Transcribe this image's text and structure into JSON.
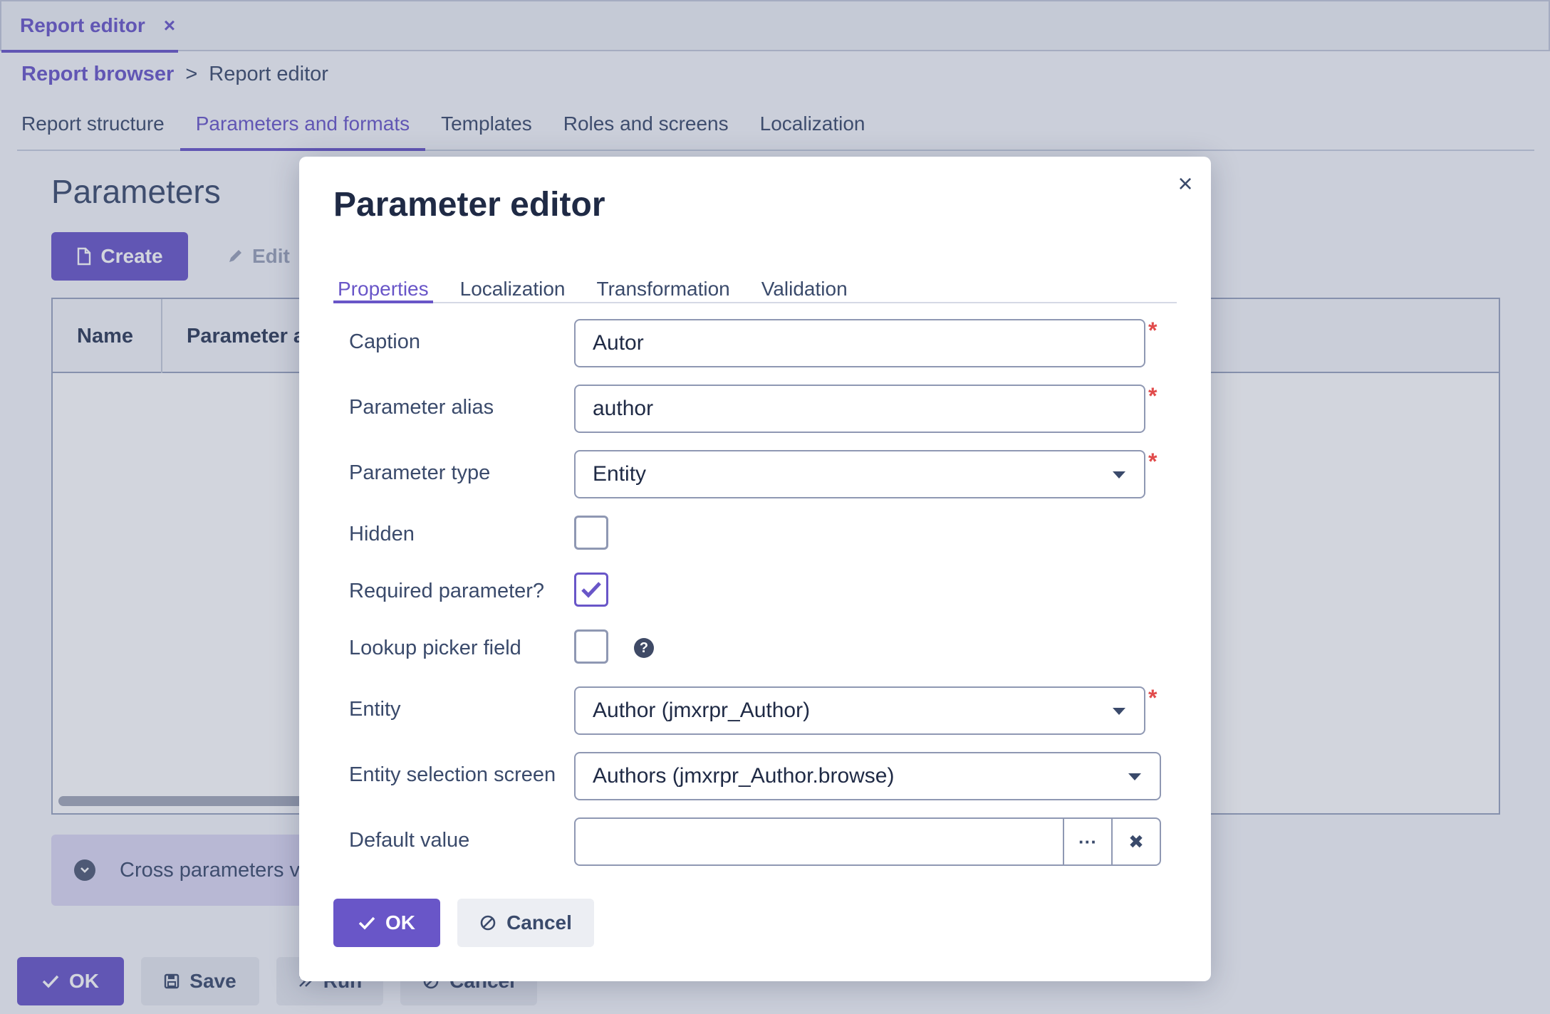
{
  "top_tab": {
    "label": "Report editor",
    "close": "×"
  },
  "breadcrumb": {
    "parent": "Report browser",
    "separator": ">",
    "current": "Report editor"
  },
  "main_tabs": [
    {
      "label": "Report structure"
    },
    {
      "label": "Parameters and formats"
    },
    {
      "label": "Templates"
    },
    {
      "label": "Roles and screens"
    },
    {
      "label": "Localization"
    }
  ],
  "parameters": {
    "title": "Parameters",
    "create_label": "Create",
    "edit_label": "Edit",
    "columns": [
      "Name",
      "Parameter a"
    ],
    "cross_label": "Cross parameters v"
  },
  "footer": {
    "ok": "OK",
    "save": "Save",
    "run": "Run",
    "cancel": "Cancel"
  },
  "dialog": {
    "title": "Parameter editor",
    "close": "×",
    "tabs": [
      {
        "label": "Properties"
      },
      {
        "label": "Localization"
      },
      {
        "label": "Transformation"
      },
      {
        "label": "Validation"
      }
    ],
    "fields": {
      "caption": {
        "label": "Caption",
        "value": "Autor"
      },
      "alias": {
        "label": "Parameter alias",
        "value": "author"
      },
      "type": {
        "label": "Parameter type",
        "value": "Entity"
      },
      "hidden": {
        "label": "Hidden",
        "checked": false
      },
      "required": {
        "label": "Required parameter?",
        "checked": true
      },
      "lookup": {
        "label": "Lookup picker field",
        "checked": false
      },
      "entity": {
        "label": "Entity",
        "value": "Author (jmxrpr_Author)"
      },
      "screen": {
        "label": "Entity selection screen",
        "value": "Authors (jmxrpr_Author.browse)"
      },
      "default": {
        "label": "Default value",
        "value": ""
      }
    },
    "required_mark": "*",
    "ok": "OK",
    "cancel": "Cancel"
  },
  "colors": {
    "accent": "#6956c8",
    "required": "#e14b4b",
    "text": "#3a4a6b"
  },
  "icons": [
    "close-icon",
    "file-icon",
    "pencil-icon",
    "chevron-down-icon",
    "check-icon",
    "save-icon",
    "run-icon",
    "cancel-icon",
    "question-icon",
    "ellipsis-icon",
    "clear-icon"
  ]
}
